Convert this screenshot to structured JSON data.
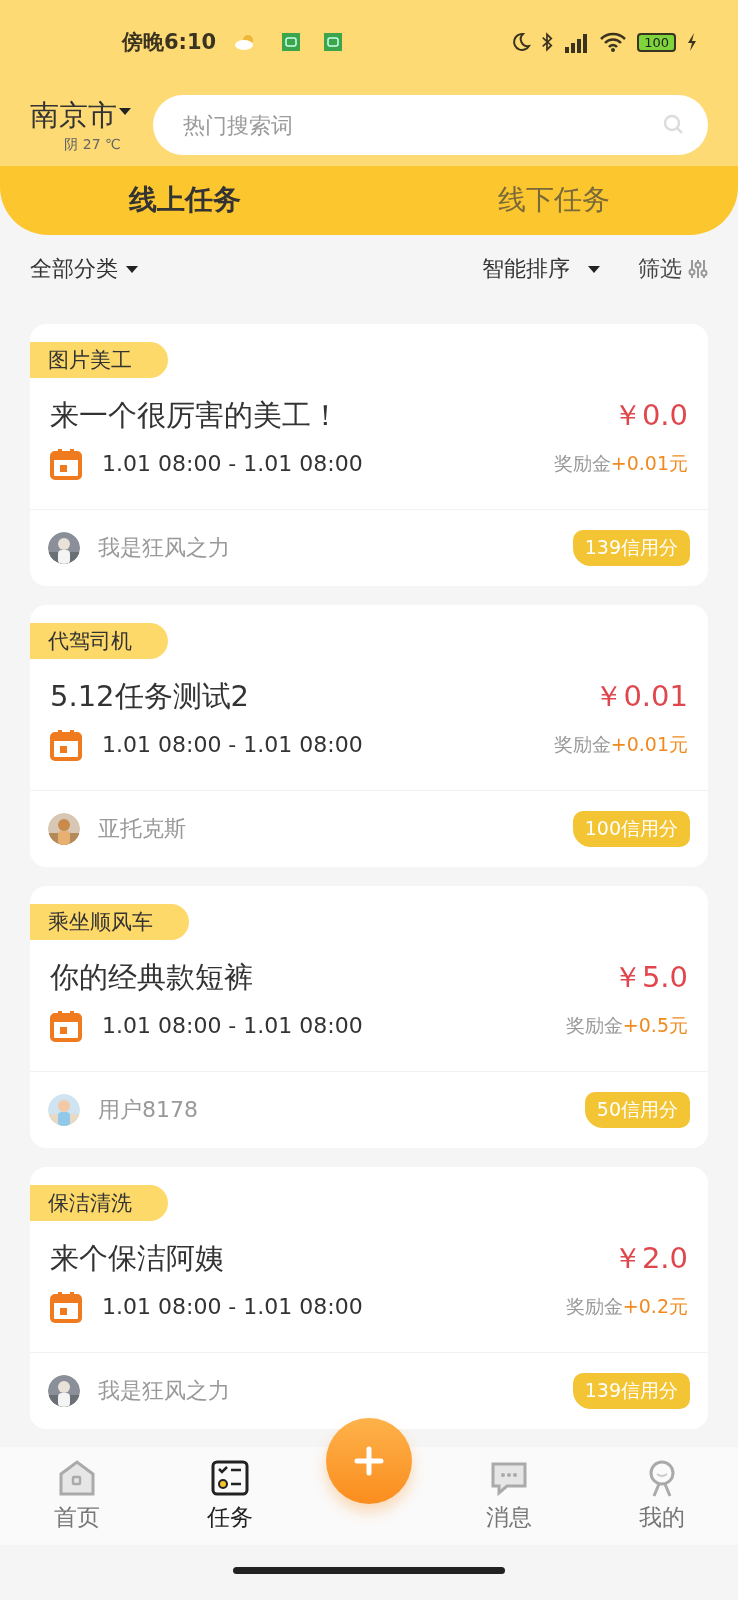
{
  "status_bar": {
    "time": "傍晚6:10",
    "battery": "100"
  },
  "header": {
    "city": "南京市",
    "weather": "阴 27 ℃",
    "search": {
      "placeholder": "热门搜索词"
    }
  },
  "tabs": [
    {
      "label": "线上任务",
      "selected": true
    },
    {
      "label": "线下任务",
      "selected": false
    }
  ],
  "filters": {
    "category": "全部分类",
    "sort": "智能排序",
    "filter": "筛选"
  },
  "tasks": [
    {
      "category": "图片美工",
      "title": "来一个很厉害的美工！",
      "price": "￥0.0",
      "time": "1.01 08:00 - 1.01 08:00",
      "bonus_label": "奖励金",
      "bonus": "+0.01元",
      "user": "我是狂风之力",
      "credit": "139信用分"
    },
    {
      "category": "代驾司机",
      "title": "5.12任务测试2",
      "price": "￥0.01",
      "time": "1.01 08:00 - 1.01 08:00",
      "bonus_label": "奖励金",
      "bonus": "+0.01元",
      "user": "亚托克斯",
      "credit": "100信用分"
    },
    {
      "category": "乘坐顺风车",
      "title": "你的经典款短裤",
      "price": "￥5.0",
      "time": "1.01 08:00 - 1.01 08:00",
      "bonus_label": "奖励金",
      "bonus": "+0.5元",
      "user": "用户8178",
      "credit": "50信用分"
    },
    {
      "category": "保洁清洗",
      "title": "来个保洁阿姨",
      "price": "￥2.0",
      "time": "1.01 08:00 - 1.01 08:00",
      "bonus_label": "奖励金",
      "bonus": "+0.2元",
      "user": "我是狂风之力",
      "credit": "139信用分"
    }
  ],
  "bottom_nav": [
    {
      "label": "首页",
      "kind": "home",
      "selected": false
    },
    {
      "label": "任务",
      "kind": "task",
      "selected": true
    },
    {
      "kind": "add"
    },
    {
      "label": "消息",
      "kind": "message",
      "selected": false
    },
    {
      "label": "我的",
      "kind": "profile",
      "selected": false
    }
  ]
}
